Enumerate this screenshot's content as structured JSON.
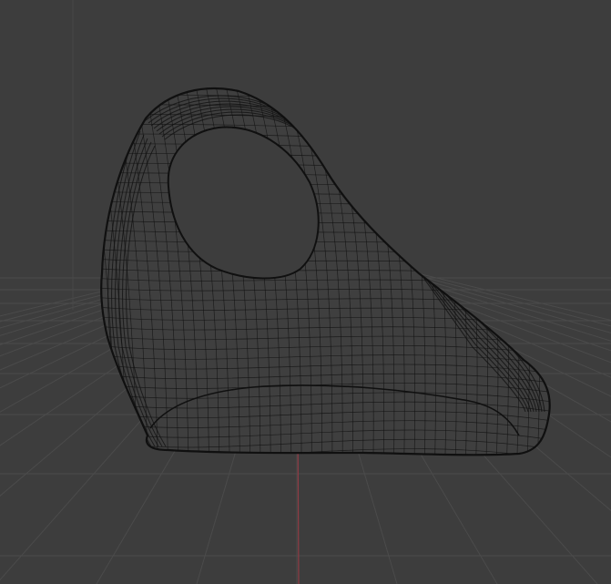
{
  "viewport": {
    "label": "",
    "background": "#3d3d3d",
    "grid_color": "#4b4b4b",
    "axis_z_color": "#8f3b44",
    "mesh_stroke": "#101010",
    "mesh_fill": "#3f3f3f",
    "object_icon": "wireframe-mesh-icon"
  }
}
